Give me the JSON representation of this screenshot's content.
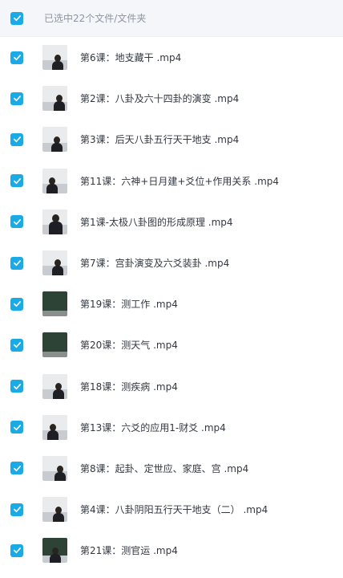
{
  "header": {
    "title": "已选中22个文件/文件夹"
  },
  "colors": {
    "accent": "#1aabe6",
    "header_background": "#f4f6f9"
  },
  "files": [
    {
      "name": "第6课：地支藏干 .mp4",
      "checked": true,
      "thumb_icon": "video-thumbnail"
    },
    {
      "name": "第2课：八卦及六十四卦的演变 .mp4",
      "checked": true,
      "thumb_icon": "video-thumbnail"
    },
    {
      "name": "第3课：后天八卦五行天干地支 .mp4",
      "checked": true,
      "thumb_icon": "video-thumbnail"
    },
    {
      "name": "第11课：六神+日月建+爻位+作用关系 .mp4",
      "checked": true,
      "thumb_icon": "video-thumbnail"
    },
    {
      "name": "第1课-太极八卦图的形成原理 .mp4",
      "checked": true,
      "thumb_icon": "video-thumbnail"
    },
    {
      "name": "第7课：宫卦演变及六爻装卦 .mp4",
      "checked": true,
      "thumb_icon": "video-thumbnail"
    },
    {
      "name": "第19课：测工作 .mp4",
      "checked": true,
      "thumb_icon": "video-thumbnail"
    },
    {
      "name": "第20课：测天气 .mp4",
      "checked": true,
      "thumb_icon": "video-thumbnail"
    },
    {
      "name": "第18课：测疾病 .mp4",
      "checked": true,
      "thumb_icon": "video-thumbnail"
    },
    {
      "name": "第13课：六爻的应用1-财爻 .mp4",
      "checked": true,
      "thumb_icon": "video-thumbnail"
    },
    {
      "name": "第8课：起卦、定世应、家庭、宫 .mp4",
      "checked": true,
      "thumb_icon": "video-thumbnail"
    },
    {
      "name": "第4课：八卦阴阳五行天干地支（二） .mp4",
      "checked": true,
      "thumb_icon": "video-thumbnail"
    },
    {
      "name": "第21课：测官运 .mp4",
      "checked": true,
      "thumb_icon": "video-thumbnail"
    }
  ]
}
